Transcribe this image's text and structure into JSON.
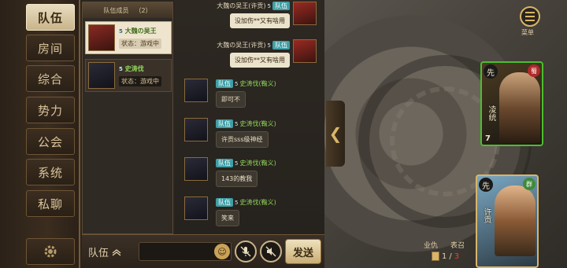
{
  "tabs": [
    "队伍",
    "房间",
    "综合",
    "势力",
    "公会",
    "系统",
    "私聊"
  ],
  "team": {
    "header_label": "队伍成员",
    "header_count": "（2）",
    "members": [
      {
        "name": "大魏の吴王",
        "vip": "5",
        "status": "状态：游戏中"
      },
      {
        "name": "史涛伐",
        "vip": "5",
        "status": "状态：游戏中"
      }
    ]
  },
  "chat": {
    "messages": [
      {
        "side": "right",
        "speaker": "大魏の吴王(许贡)",
        "vip": "5",
        "channel": "队伍",
        "text": "没加伤**又有啥用"
      },
      {
        "side": "right",
        "speaker": "大魏の吴王(许贡)",
        "vip": "5",
        "channel": "队伍",
        "text": "没加伤**又有啥用"
      },
      {
        "side": "left",
        "speaker": "史涛伐(鞠义)",
        "vip": "5",
        "channel": "队伍",
        "text": "即可不"
      },
      {
        "side": "left",
        "speaker": "史涛伐(鞠义)",
        "vip": "5",
        "channel": "队伍",
        "text": "许贡sss级神经"
      },
      {
        "side": "left",
        "speaker": "史涛伐(鞠义)",
        "vip": "5",
        "channel": "队伍",
        "text": "143的教我"
      },
      {
        "side": "left",
        "speaker": "史涛伐(鞠义)",
        "vip": "5",
        "channel": "队伍",
        "text": "笑来"
      }
    ]
  },
  "bottom_bar": {
    "channel_label": "队伍",
    "input_placeholder": "",
    "send_label": "发送"
  },
  "menu": {
    "label": "菜单"
  },
  "cards": [
    {
      "badge": "先",
      "faction": "蜀",
      "name": "凌统",
      "hp": "7"
    },
    {
      "badge": "先",
      "faction": "群",
      "name": "许贡",
      "hp": ""
    }
  ],
  "pile": {
    "labels": [
      "业仇",
      "表召"
    ],
    "current": "1",
    "separator": "/",
    "max": "3"
  },
  "colors": {
    "accent_teal": "#3f9fa6",
    "gold": "#d9b56a",
    "green_name": "#8fd45a",
    "card_green_border": "#4cbd2e"
  }
}
